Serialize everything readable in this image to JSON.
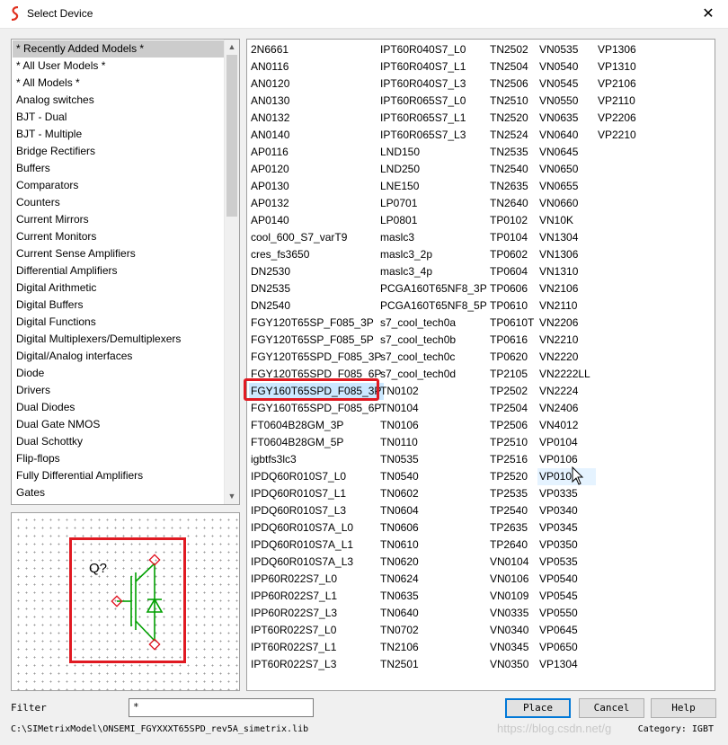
{
  "window": {
    "title": "Select Device",
    "close_glyph": "✕"
  },
  "categories": {
    "items": [
      "* Recently Added Models *",
      "* All User Models *",
      "* All Models *",
      "Analog switches",
      "BJT - Dual",
      "BJT - Multiple",
      "Bridge Rectifiers",
      "Buffers",
      "Comparators",
      "Counters",
      "Current Mirrors",
      "Current Monitors",
      "Current Sense Amplifiers",
      "Differential Amplifiers",
      "Digital Arithmetic",
      "Digital Buffers",
      "Digital Functions",
      "Digital Multiplexers/Demultiplexers",
      "Digital/Analog interfaces",
      "Diode",
      "Drivers",
      "Dual Diodes",
      "Dual Gate NMOS",
      "Dual Schottky",
      "Flip-flops",
      "Fully Differential Amplifiers",
      "Gates"
    ],
    "selected_index": 0
  },
  "preview": {
    "symbol_label": "Q?"
  },
  "models": {
    "columns": [
      [
        "2N6661",
        "AN0116",
        "AN0120",
        "AN0130",
        "AN0132",
        "AN0140",
        "AP0116",
        "AP0120",
        "AP0130",
        "AP0132",
        "AP0140",
        "cool_600_S7_varT9",
        "cres_fs3650",
        "DN2530",
        "DN2535",
        "DN2540",
        "FGY120T65SP_F085_3P",
        "FGY120T65SP_F085_5P",
        "FGY120T65SPD_F085_3P",
        "FGY120T65SPD_F085_6P",
        "FGY160T65SPD_F085_3P",
        "FGY160T65SPD_F085_6P",
        "FT0604B28GM_3P",
        "FT0604B28GM_5P",
        "igbtfs3lc3",
        "IPDQ60R010S7_L0",
        "IPDQ60R010S7_L1",
        "IPDQ60R010S7_L3",
        "IPDQ60R010S7A_L0",
        "IPDQ60R010S7A_L1",
        "IPDQ60R010S7A_L3",
        "IPP60R022S7_L0",
        "IPP60R022S7_L1",
        "IPP60R022S7_L3",
        "IPT60R022S7_L0",
        "IPT60R022S7_L1",
        "IPT60R022S7_L3"
      ],
      [
        "IPT60R040S7_L0",
        "IPT60R040S7_L1",
        "IPT60R040S7_L3",
        "IPT60R065S7_L0",
        "IPT60R065S7_L1",
        "IPT60R065S7_L3",
        "LND150",
        "LND250",
        "LNE150",
        "LP0701",
        "LP0801",
        "maslc3",
        "maslc3_2p",
        "maslc3_4p",
        "PCGA160T65NF8_3P",
        "PCGA160T65NF8_5P",
        "s7_cool_tech0a",
        "s7_cool_tech0b",
        "s7_cool_tech0c",
        "s7_cool_tech0d",
        "TN0102",
        "TN0104",
        "TN0106",
        "TN0110",
        "TN0535",
        "TN0540",
        "TN0602",
        "TN0604",
        "TN0606",
        "TN0610",
        "TN0620",
        "TN0624",
        "TN0635",
        "TN0640",
        "TN0702",
        "TN2106",
        "TN2501"
      ],
      [
        "TN2502",
        "TN2504",
        "TN2506",
        "TN2510",
        "TN2520",
        "TN2524",
        "TN2535",
        "TN2540",
        "TN2635",
        "TN2640",
        "TP0102",
        "TP0104",
        "TP0602",
        "TP0604",
        "TP0606",
        "TP0610",
        "TP0610T",
        "TP0616",
        "TP0620",
        "TP2105",
        "TP2502",
        "TP2504",
        "TP2506",
        "TP2510",
        "TP2516",
        "TP2520",
        "TP2535",
        "TP2540",
        "TP2635",
        "TP2640",
        "VN0104",
        "VN0106",
        "VN0109",
        "VN0335",
        "VN0340",
        "VN0345",
        "VN0350"
      ],
      [
        "VN0535",
        "VN0540",
        "VN0545",
        "VN0550",
        "VN0635",
        "VN0640",
        "VN0645",
        "VN0650",
        "VN0655",
        "VN0660",
        "VN10K",
        "VN1304",
        "VN1306",
        "VN1310",
        "VN2106",
        "VN2110",
        "VN2206",
        "VN2210",
        "VN2220",
        "VN2222LL",
        "VN2224",
        "VN2406",
        "VN4012",
        "VP0104",
        "VP0106",
        "VP0109",
        "VP0335",
        "VP0340",
        "VP0345",
        "VP0350",
        "VP0535",
        "VP0540",
        "VP0545",
        "VP0550",
        "VP0645",
        "VP0650",
        "VP1304"
      ],
      [
        "VP1306",
        "VP1310",
        "VP2106",
        "VP2110",
        "VP2206",
        "VP2210"
      ]
    ],
    "selected": {
      "column": 0,
      "row": 20
    },
    "hover": {
      "column": 3,
      "row": 25
    }
  },
  "bottom": {
    "filter_label": "Filter",
    "filter_value": "*",
    "place_label": "Place",
    "cancel_label": "Cancel",
    "help_label": "Help",
    "file_path": "C:\\SIMetrixModel\\ONSEMI_FGYXXXT65SPD_rev5A_simetrix.lib",
    "category_text": "Category: IGBT",
    "watermark": "https://blog.csdn.net/g"
  }
}
